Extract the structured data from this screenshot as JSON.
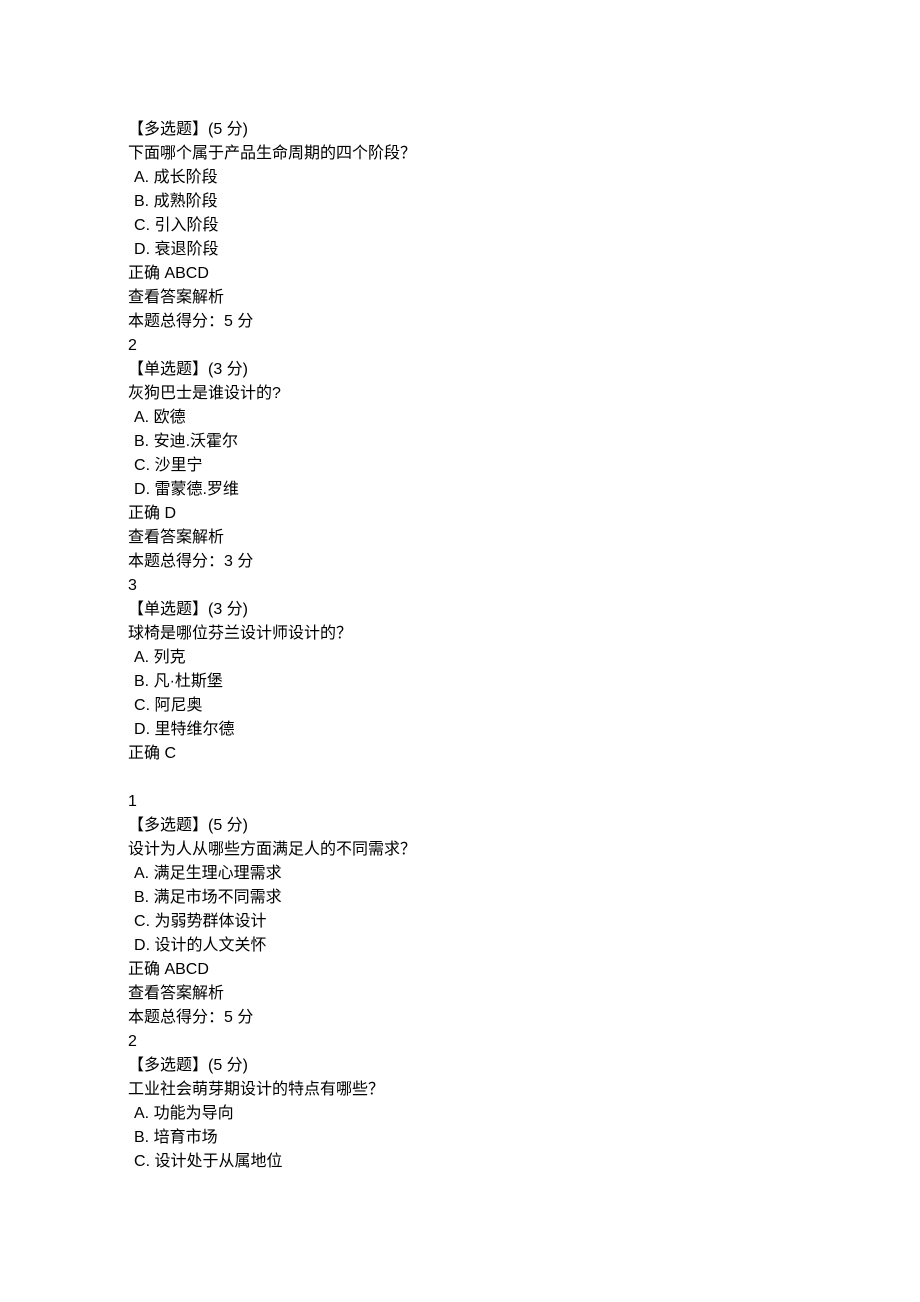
{
  "questions": [
    {
      "type_label": "【多选题】(5 分)",
      "prompt": "下面哪个属于产品生命周期的四个阶段？",
      "options": [
        {
          "key": "A",
          "text": "成长阶段"
        },
        {
          "key": "B",
          "text": "成熟阶段"
        },
        {
          "key": "C",
          "text": "引入阶段"
        },
        {
          "key": "D",
          "text": "衰退阶段"
        }
      ],
      "correct": "正确 ABCD",
      "view_answer": "查看答案解析",
      "score_line": "本题总得分：5 分",
      "next_num": "2"
    },
    {
      "type_label": "【单选题】(3 分)",
      "prompt": "灰狗巴士是谁设计的?",
      "options": [
        {
          "key": "A",
          "text": "欧德"
        },
        {
          "key": "B",
          "text": "安迪.沃霍尔"
        },
        {
          "key": "C",
          "text": "沙里宁"
        },
        {
          "key": "D",
          "text": "雷蒙德.罗维"
        }
      ],
      "correct": "正确 D",
      "view_answer": "查看答案解析",
      "score_line": "本题总得分：3 分",
      "next_num": "3"
    },
    {
      "type_label": "【单选题】(3 分)",
      "prompt": "球椅是哪位芬兰设计师设计的？",
      "options": [
        {
          "key": "A",
          "text": "列克"
        },
        {
          "key": "B",
          "text": "凡·杜斯堡"
        },
        {
          "key": "C",
          "text": "阿尼奥"
        },
        {
          "key": "D",
          "text": "里特维尔德"
        }
      ],
      "correct": "正确 C",
      "view_answer": null,
      "score_line": null,
      "next_num": null
    },
    {
      "lead_num": "1",
      "type_label": "【多选题】(5 分)",
      "prompt": "设计为人从哪些方面满足人的不同需求？",
      "options": [
        {
          "key": "A",
          "text": "满足生理心理需求"
        },
        {
          "key": "B",
          "text": "满足市场不同需求"
        },
        {
          "key": "C",
          "text": "为弱势群体设计"
        },
        {
          "key": "D",
          "text": "设计的人文关怀"
        }
      ],
      "correct": "正确 ABCD",
      "view_answer": "查看答案解析",
      "score_line": "本题总得分：5 分",
      "next_num": "2"
    },
    {
      "type_label": "【多选题】(5 分)",
      "prompt": "工业社会萌芽期设计的特点有哪些？",
      "options": [
        {
          "key": "A",
          "text": "功能为导向"
        },
        {
          "key": "B",
          "text": "培育市场"
        },
        {
          "key": "C",
          "text": "设计处于从属地位"
        }
      ],
      "correct": null,
      "view_answer": null,
      "score_line": null,
      "next_num": null
    }
  ]
}
